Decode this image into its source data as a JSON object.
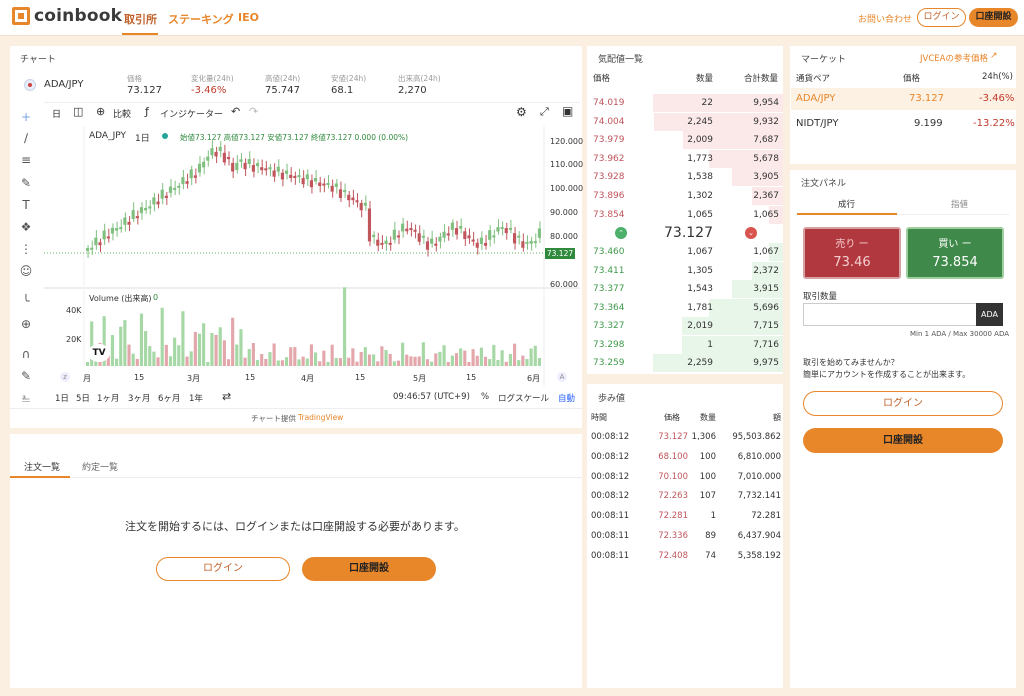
{
  "header": {
    "logo_text": "coinbook",
    "nav": [
      "取引所",
      "ステーキング",
      "IEO"
    ],
    "contact": "お問い合わせ",
    "login": "ログイン",
    "open_account": "口座開設"
  },
  "chart_panel": {
    "title": "チャート",
    "pair": "ADA/JPY",
    "stats": [
      {
        "label": "価格",
        "value": "73.127"
      },
      {
        "label": "変化量(24h)",
        "value": "-3.46%"
      },
      {
        "label": "高値(24h)",
        "value": "75.747"
      },
      {
        "label": "安値(24h)",
        "value": "68.1"
      },
      {
        "label": "出来高(24h)",
        "value": "2,270"
      }
    ],
    "toolbar": {
      "interval": "日",
      "compare": "比較",
      "indicators": "インジケーター"
    },
    "legend": {
      "symbol": "ADA_JPY",
      "interval": "1日",
      "ohlc": "始値73.127 高値73.127 安値73.127 終値73.127 0.000 (0.00%)"
    },
    "volume_label": "Volume (出来高)",
    "volume_value": "0",
    "price_ticks": [
      "120.000",
      "110.000",
      "100.000",
      "90.000",
      "80.000",
      "60.000"
    ],
    "current_price_tag": "73.127",
    "volume_ticks": [
      "40K",
      "20K"
    ],
    "time_ticks": [
      "月",
      "15",
      "3月",
      "15",
      "4月",
      "15",
      "5月",
      "15",
      "6月"
    ],
    "ranges": [
      "1日",
      "5日",
      "1ヶ月",
      "3ヶ月",
      "6ヶ月",
      "1年"
    ],
    "clock": "09:46:57 (UTC+9)",
    "percent": "%",
    "log_scale": "ログスケール",
    "auto": "自動",
    "credit_prefix": "チャート提供",
    "credit_link": "TradingView",
    "colors": {
      "up": "#7fbf7f",
      "down": "#c0555c"
    }
  },
  "orders_panel": {
    "tabs": [
      "注文一覧",
      "約定一覧"
    ],
    "message": "注文を開始するには、ログインまたは口座開設する必要があります。",
    "login": "ログイン",
    "open_account": "口座開設"
  },
  "orderbook": {
    "title": "気配値一覧",
    "headers": [
      "価格",
      "数量",
      "合計数量"
    ],
    "asks": [
      {
        "price": "74.019",
        "qty": "22",
        "total": "9,954"
      },
      {
        "price": "74.004",
        "qty": "2,245",
        "total": "9,932"
      },
      {
        "price": "73.979",
        "qty": "2,009",
        "total": "7,687"
      },
      {
        "price": "73.962",
        "qty": "1,773",
        "total": "5,678"
      },
      {
        "price": "73.928",
        "qty": "1,538",
        "total": "3,905"
      },
      {
        "price": "73.896",
        "qty": "1,302",
        "total": "2,367"
      },
      {
        "price": "73.854",
        "qty": "1,065",
        "total": "1,065"
      }
    ],
    "mid_price": "73.127",
    "bids": [
      {
        "price": "73.460",
        "qty": "1,067",
        "total": "1,067"
      },
      {
        "price": "73.411",
        "qty": "1,305",
        "total": "2,372"
      },
      {
        "price": "73.377",
        "qty": "1,543",
        "total": "3,915"
      },
      {
        "price": "73.364",
        "qty": "1,781",
        "total": "5,696"
      },
      {
        "price": "73.327",
        "qty": "2,019",
        "total": "7,715"
      },
      {
        "price": "73.298",
        "qty": "1",
        "total": "7,716"
      },
      {
        "price": "73.259",
        "qty": "2,259",
        "total": "9,975"
      }
    ]
  },
  "trades": {
    "title": "歩み値",
    "headers": [
      "時間",
      "価格",
      "数量",
      "額"
    ],
    "rows": [
      {
        "time": "00:08:12",
        "price": "73.127",
        "qty": "1,306",
        "amount": "95,503.862"
      },
      {
        "time": "00:08:12",
        "price": "68.100",
        "qty": "100",
        "amount": "6,810.000"
      },
      {
        "time": "00:08:12",
        "price": "70.100",
        "qty": "100",
        "amount": "7,010.000"
      },
      {
        "time": "00:08:12",
        "price": "72.263",
        "qty": "107",
        "amount": "7,732.141"
      },
      {
        "time": "00:08:11",
        "price": "72.281",
        "qty": "1",
        "amount": "72.281"
      },
      {
        "time": "00:08:11",
        "price": "72.336",
        "qty": "89",
        "amount": "6,437.904"
      },
      {
        "time": "00:08:11",
        "price": "72.408",
        "qty": "74",
        "amount": "5,358.192"
      }
    ]
  },
  "market": {
    "title": "マーケット",
    "ref_link": "JVCEAの参考価格",
    "headers": [
      "通貨ペア",
      "価格",
      "24h(%)"
    ],
    "rows": [
      {
        "pair": "ADA/JPY",
        "price": "73.127",
        "change": "-3.46%"
      },
      {
        "pair": "NIDT/JPY",
        "price": "9.199",
        "change": "-13.22%"
      }
    ]
  },
  "order_panel": {
    "title": "注文パネル",
    "tabs": [
      "成行",
      "指値"
    ],
    "sell_label": "売り ー",
    "sell_price": "73.46",
    "buy_label": "買い ー",
    "buy_price": "73.854",
    "qty_label": "取引数量",
    "qty_value": "",
    "unit": "ADA",
    "limits": "Min 1 ADA / Max 30000 ADA",
    "promo1": "取引を始めてみませんか？",
    "promo2": "簡単にアカウントを作成することが出来ます。",
    "login": "ログイン",
    "open_account": "口座開設"
  }
}
